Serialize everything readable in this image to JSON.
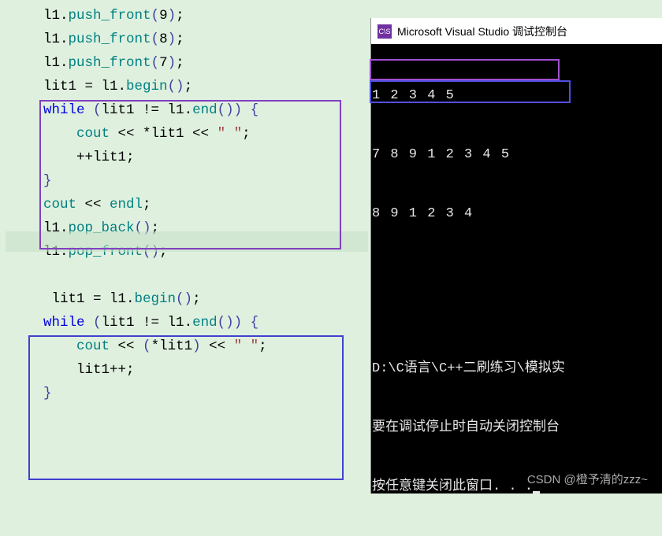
{
  "code": {
    "l1": "l1.push_front(9);",
    "l2": "l1.push_front(8);",
    "l3": "l1.push_front(7);",
    "l4": "lit1 = l1.begin();",
    "l5": "while (lit1 != l1.end()) {",
    "l6": "    cout << *lit1 << \" \";",
    "l7": "    ++lit1;",
    "l8": "}",
    "l9": "cout << endl;",
    "l10": "l1.pop_back();",
    "l11": "l1.pop_front();",
    "l12": "",
    "l13": " lit1 = l1.begin();",
    "l14": "while (lit1 != l1.end()) {",
    "l15": "    cout << (*lit1) << \" \";",
    "l16": "    lit1++;",
    "l17": "}",
    "push_front": "push_front",
    "pop_back": "pop_back",
    "pop_front": "pop_front",
    "begin": "begin",
    "end": "end",
    "while": "while",
    "cout": "cout",
    "endl": "endl",
    "space_str": "\" \""
  },
  "console": {
    "title": "Microsoft Visual Studio 调试控制台",
    "out1": "1 2 3 4 5",
    "out2": "7 8 9 1 2 3 4 5",
    "out3": "8 9 1 2 3 4",
    "path": "D:\\C语言\\C++二刷练习\\模拟实",
    "msg1": "要在调试停止时自动关闭控制台",
    "msg2": "按任意键关闭此窗口. . ."
  },
  "watermark": "CSDN @橙予清的zzz~"
}
